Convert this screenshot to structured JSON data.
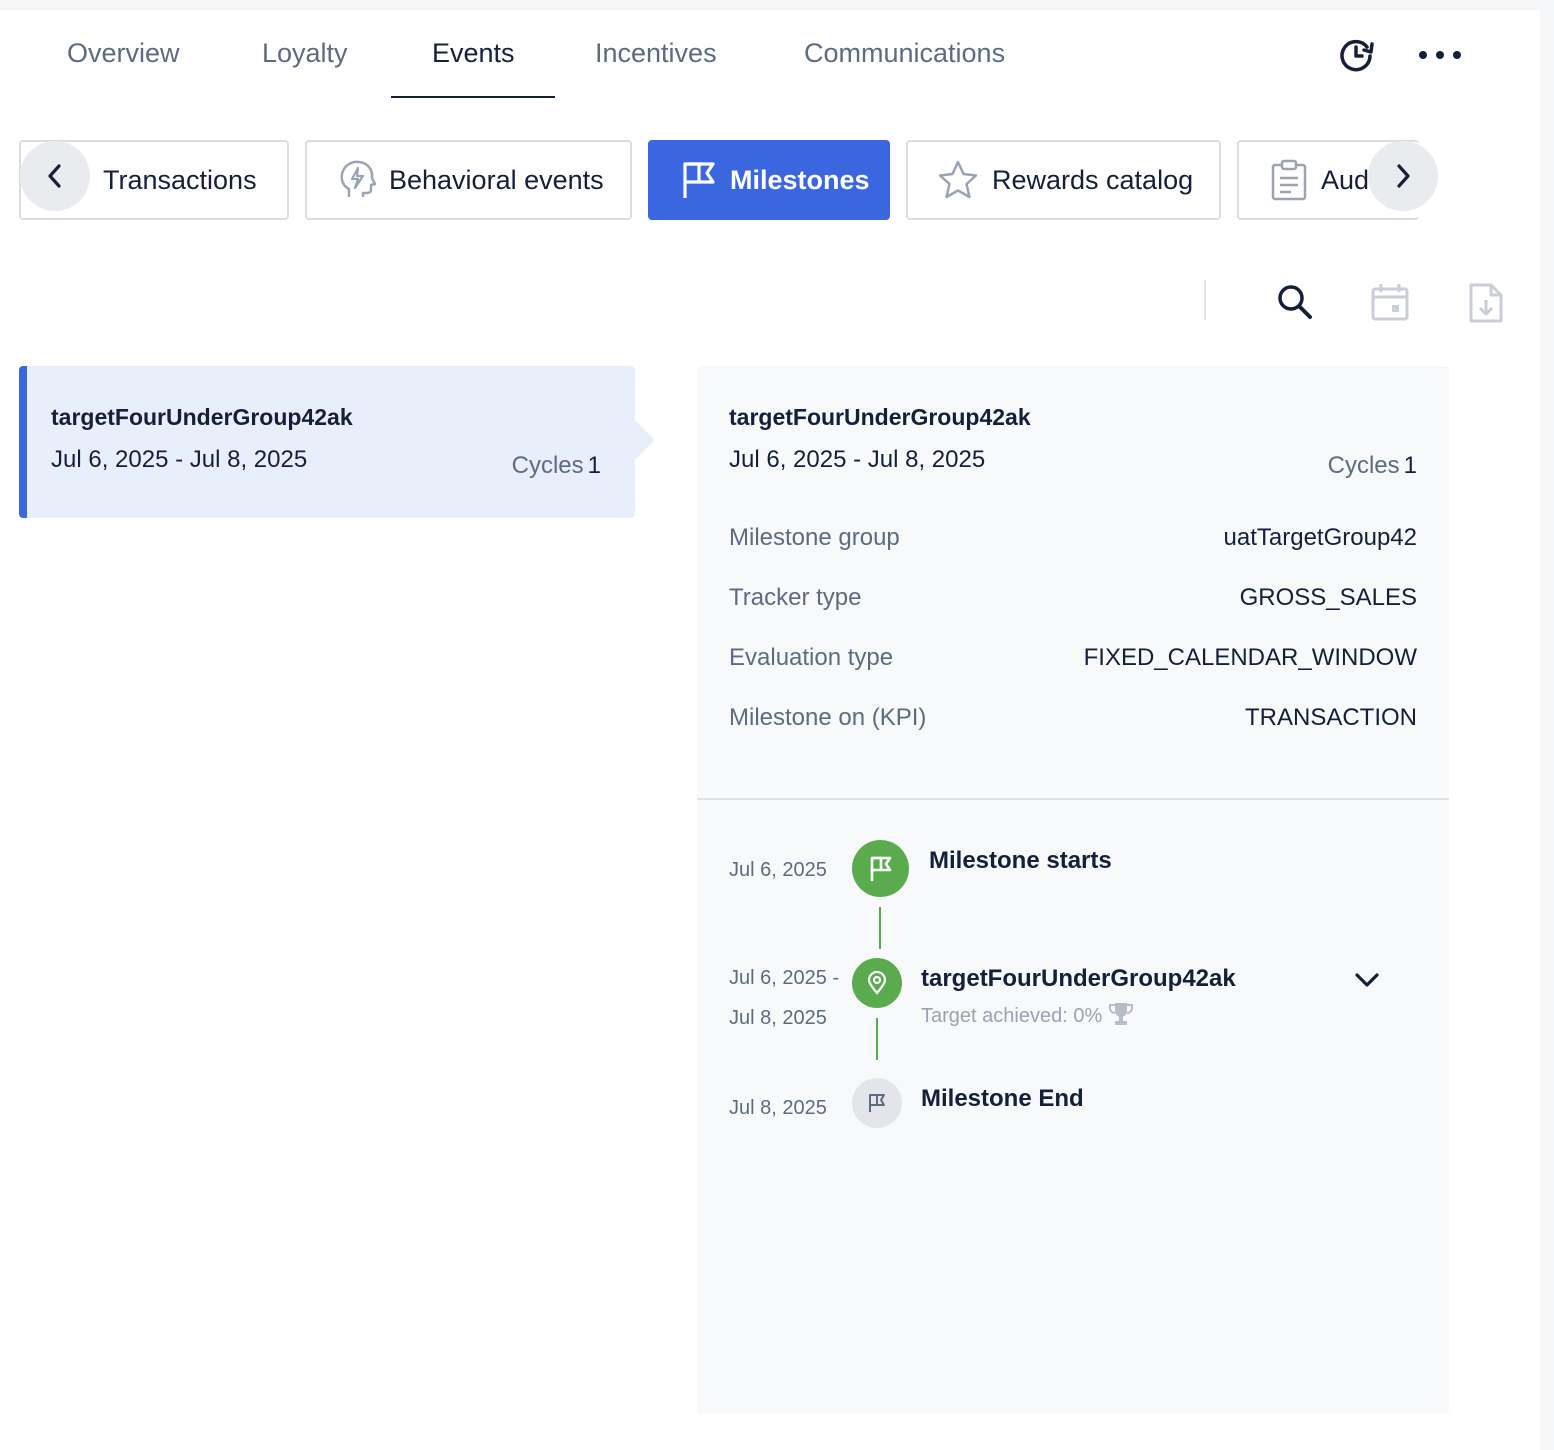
{
  "top_tabs": [
    {
      "label": "Overview"
    },
    {
      "label": "Loyalty"
    },
    {
      "label": "Events"
    },
    {
      "label": "Incentives"
    },
    {
      "label": "Communications"
    }
  ],
  "active_top_tab": "Events",
  "sub_tabs": [
    {
      "label": "Transactions",
      "icon": "receipt-icon"
    },
    {
      "label": "Behavioral events",
      "icon": "head-bolt-icon"
    },
    {
      "label": "Milestones",
      "icon": "flag-icon"
    },
    {
      "label": "Rewards catalog",
      "icon": "star-icon"
    },
    {
      "label": "Aud",
      "icon": "clipboard-icon"
    }
  ],
  "active_sub_tab": "Milestones",
  "accent_color": "#3a66e0",
  "success_color": "#5aab4e",
  "list": [
    {
      "title": "targetFourUnderGroup42ak",
      "date_range": "Jul 6, 2025 - Jul 8, 2025",
      "cycles_label": "Cycles",
      "cycles_value": "1"
    }
  ],
  "detail": {
    "title": "targetFourUnderGroup42ak",
    "date_range": "Jul 6, 2025 - Jul 8, 2025",
    "cycles_label": "Cycles",
    "cycles_value": "1",
    "fields": [
      {
        "label": "Milestone group",
        "value": "uatTargetGroup42"
      },
      {
        "label": "Tracker type",
        "value": "GROSS_SALES"
      },
      {
        "label": "Evaluation type",
        "value": "FIXED_CALENDAR_WINDOW"
      },
      {
        "label": "Milestone on (KPI)",
        "value": "TRANSACTION"
      }
    ],
    "timeline": {
      "start": {
        "date": "Jul 6, 2025",
        "title": "Milestone starts"
      },
      "cycle": {
        "date_start": "Jul 6, 2025 -",
        "date_end": "Jul 8, 2025",
        "title": "targetFourUnderGroup42ak",
        "subtitle": "Target achieved: 0%"
      },
      "end": {
        "date": "Jul 8, 2025",
        "title": "Milestone End"
      }
    }
  }
}
